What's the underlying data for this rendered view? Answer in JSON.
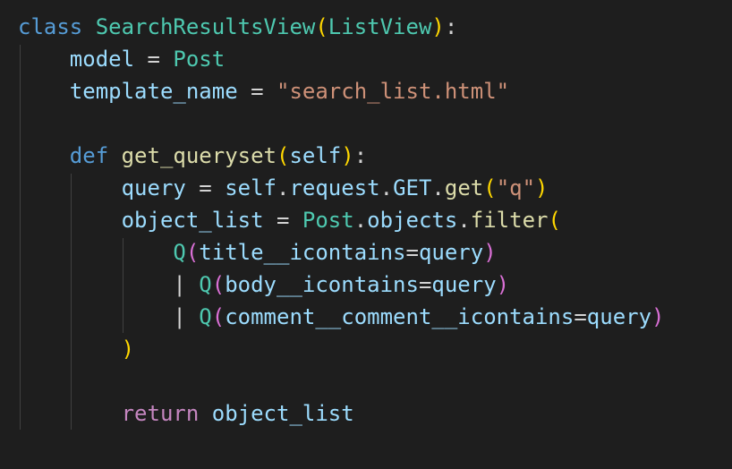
{
  "code": {
    "l1": {
      "kw": "class",
      "name": "SearchResultsView",
      "open": "(",
      "base": "ListView",
      "close": ")",
      "colon": ":"
    },
    "l2": {
      "attr": "model",
      "eq": " = ",
      "val": "Post"
    },
    "l3": {
      "attr": "template_name",
      "eq": " = ",
      "str": "\"search_list.html\""
    },
    "l5": {
      "kw": "def",
      "fn": "get_queryset",
      "open": "(",
      "param": "self",
      "close": ")",
      "colon": ":"
    },
    "l6": {
      "var": "query",
      "eq": " = ",
      "obj": "self",
      "d1": ".",
      "attr1": "request",
      "d2": ".",
      "attr2": "GET",
      "d3": ".",
      "fn": "get",
      "open": "(",
      "str": "\"q\"",
      "close": ")"
    },
    "l7": {
      "var": "object_list",
      "eq": " = ",
      "cls": "Post",
      "d1": ".",
      "attr": "objects",
      "d2": ".",
      "fn": "filter",
      "open": "("
    },
    "l8": {
      "cls": "Q",
      "open": "(",
      "param": "title__icontains",
      "eq": "=",
      "val": "query",
      "close": ")"
    },
    "l9": {
      "pipe": "| ",
      "cls": "Q",
      "open": "(",
      "param": "body__icontains",
      "eq": "=",
      "val": "query",
      "close": ")"
    },
    "l10": {
      "pipe": "| ",
      "cls": "Q",
      "open": "(",
      "param": "comment__comment__icontains",
      "eq": "=",
      "val": "query",
      "close": ")"
    },
    "l11": {
      "close": ")"
    },
    "l13": {
      "kw": "return",
      "val": "object_list"
    }
  },
  "colors": {
    "background": "#1e1e1e",
    "keyword": "#569cd6",
    "control_keyword": "#c586c0",
    "class_name": "#4ec9b0",
    "function_name": "#dcdcaa",
    "variable": "#9cdcfe",
    "string": "#ce9178",
    "bracket_gold": "#ffd700",
    "bracket_orchid": "#da70d6",
    "bracket_blue": "#179fff"
  }
}
